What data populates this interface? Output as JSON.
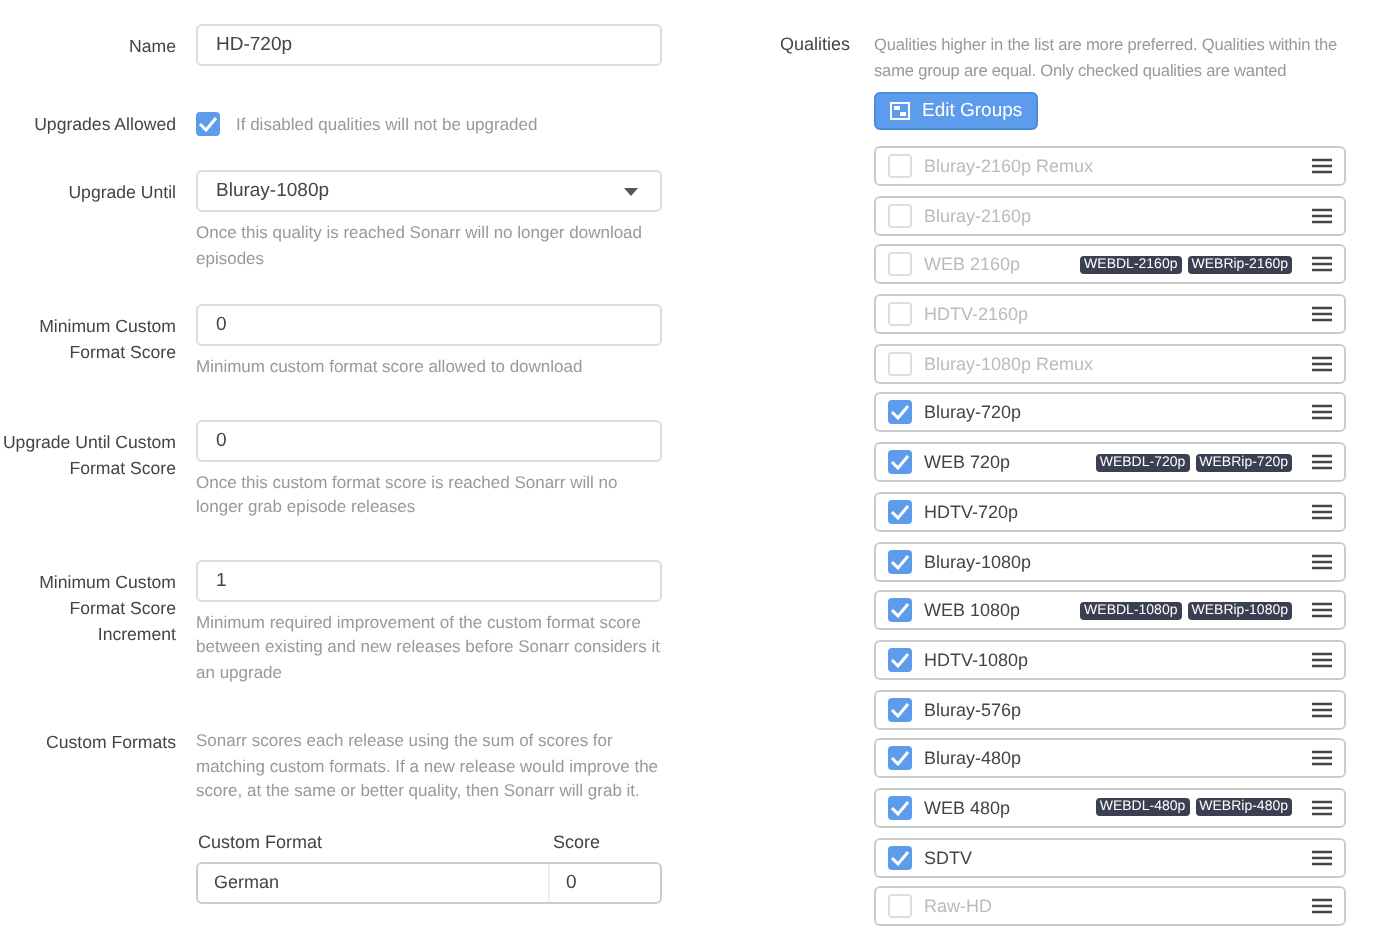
{
  "fields": [
    {
      "kind": "text",
      "label": "Name",
      "value": "HD-720p"
    },
    {
      "kind": "checkbox",
      "label": "Upgrades Allowed",
      "checked": true,
      "help": "If disabled qualities will not be upgraded"
    },
    {
      "kind": "select",
      "label": "Upgrade Until",
      "value": "Bluray-1080p",
      "help": "Once this quality is reached Sonarr will no longer download episodes"
    },
    {
      "kind": "number",
      "label": "Minimum Custom Format Score",
      "value": "0",
      "help": "Minimum custom format score allowed to download"
    },
    {
      "kind": "number",
      "label": "Upgrade Until Custom Format Score",
      "value": "0",
      "help": "Once this custom format score is reached Sonarr will no longer grab episode releases"
    },
    {
      "kind": "number",
      "label": "Minimum Custom Format Score Increment",
      "value": "1",
      "help": "Minimum required improvement of the custom format score between existing and new releases before Sonarr considers it an upgrade"
    }
  ],
  "custom_formats": {
    "label": "Custom Formats",
    "help": "Sonarr scores each release using the sum of scores for matching custom formats. If a new release would improve the score, at the same or better quality, then Sonarr will grab it.",
    "columns": [
      "Custom Format",
      "Score"
    ],
    "rows": [
      {
        "name": "German",
        "score": "0"
      }
    ]
  },
  "qualities": {
    "label": "Qualities",
    "help": "Qualities higher in the list are more preferred. Qualities within the same group are equal. Only checked qualities are wanted",
    "button": "Edit Groups",
    "items": [
      {
        "label": "Bluray-2160p Remux",
        "checked": false
      },
      {
        "label": "Bluray-2160p",
        "checked": false
      },
      {
        "label": "WEB 2160p",
        "checked": false,
        "tags": [
          "WEBDL-2160p",
          "WEBRip-2160p"
        ]
      },
      {
        "label": "HDTV-2160p",
        "checked": false
      },
      {
        "label": "Bluray-1080p Remux",
        "checked": false
      },
      {
        "label": "Bluray-720p",
        "checked": true
      },
      {
        "label": "WEB 720p",
        "checked": true,
        "tags": [
          "WEBDL-720p",
          "WEBRip-720p"
        ]
      },
      {
        "label": "HDTV-720p",
        "checked": true
      },
      {
        "label": "Bluray-1080p",
        "checked": true
      },
      {
        "label": "WEB 1080p",
        "checked": true,
        "tags": [
          "WEBDL-1080p",
          "WEBRip-1080p"
        ]
      },
      {
        "label": "HDTV-1080p",
        "checked": true
      },
      {
        "label": "Bluray-576p",
        "checked": true
      },
      {
        "label": "Bluray-480p",
        "checked": true
      },
      {
        "label": "WEB 480p",
        "checked": true,
        "tags": [
          "WEBDL-480p",
          "WEBRip-480p"
        ]
      },
      {
        "label": "SDTV",
        "checked": true
      },
      {
        "label": "Raw-HD",
        "checked": false
      }
    ]
  }
}
